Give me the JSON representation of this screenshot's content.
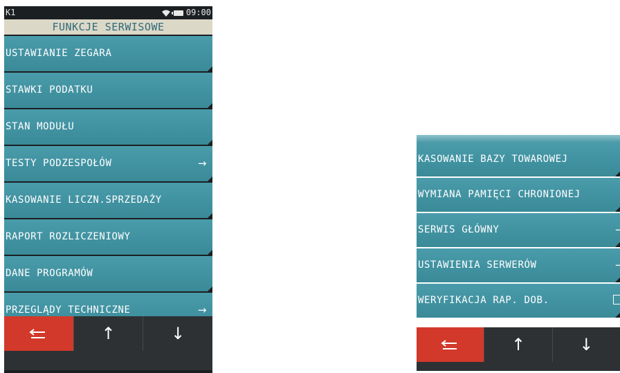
{
  "left_screen": {
    "status": {
      "carrier": "K1",
      "time": "09:00"
    },
    "title": "FUNKCJE SERWISOWE",
    "items": [
      {
        "label": "USTAWIANIE ZEGARA",
        "arrow": ""
      },
      {
        "label": "STAWKI PODATKU",
        "arrow": ""
      },
      {
        "label": "STAN MODUŁU",
        "arrow": ""
      },
      {
        "label": "TESTY PODZESPOŁÓW",
        "arrow": "→"
      },
      {
        "label": "KASOWANIE LICZN.SPRZEDAŻY",
        "arrow": ""
      },
      {
        "label": "RAPORT ROZLICZENIOWY",
        "arrow": ""
      },
      {
        "label": "DANE PROGRAMÓW",
        "arrow": ""
      },
      {
        "label": "PRZEGLĄDY TECHNICZNE",
        "arrow": "→"
      }
    ],
    "nav": {
      "up": "↑",
      "down": "↓"
    }
  },
  "right_screen": {
    "items": [
      {
        "label": "KASOWANIE BAZY TOWAROWEJ",
        "arrow": ""
      },
      {
        "label": "WYMIANA PAMIĘCI CHRONIONEJ",
        "arrow": ""
      },
      {
        "label": "SERWIS GŁÓWNY",
        "arrow": "→"
      },
      {
        "label": "USTAWIENIA SERWERÓW",
        "arrow": "→"
      },
      {
        "label": "WERYFIKACJA RAP. DOB.",
        "arrow": ""
      }
    ],
    "nav": {
      "up": "↑",
      "down": "↓"
    }
  },
  "colors": {
    "item": "#3f93a1",
    "back_button": "#d2392a",
    "title_bg": "#dcd8c8",
    "nav_bg": "#2d3134"
  },
  "icons": {
    "back": "return-arrow-icon",
    "wifi": "wifi-icon",
    "battery": "battery-icon"
  }
}
